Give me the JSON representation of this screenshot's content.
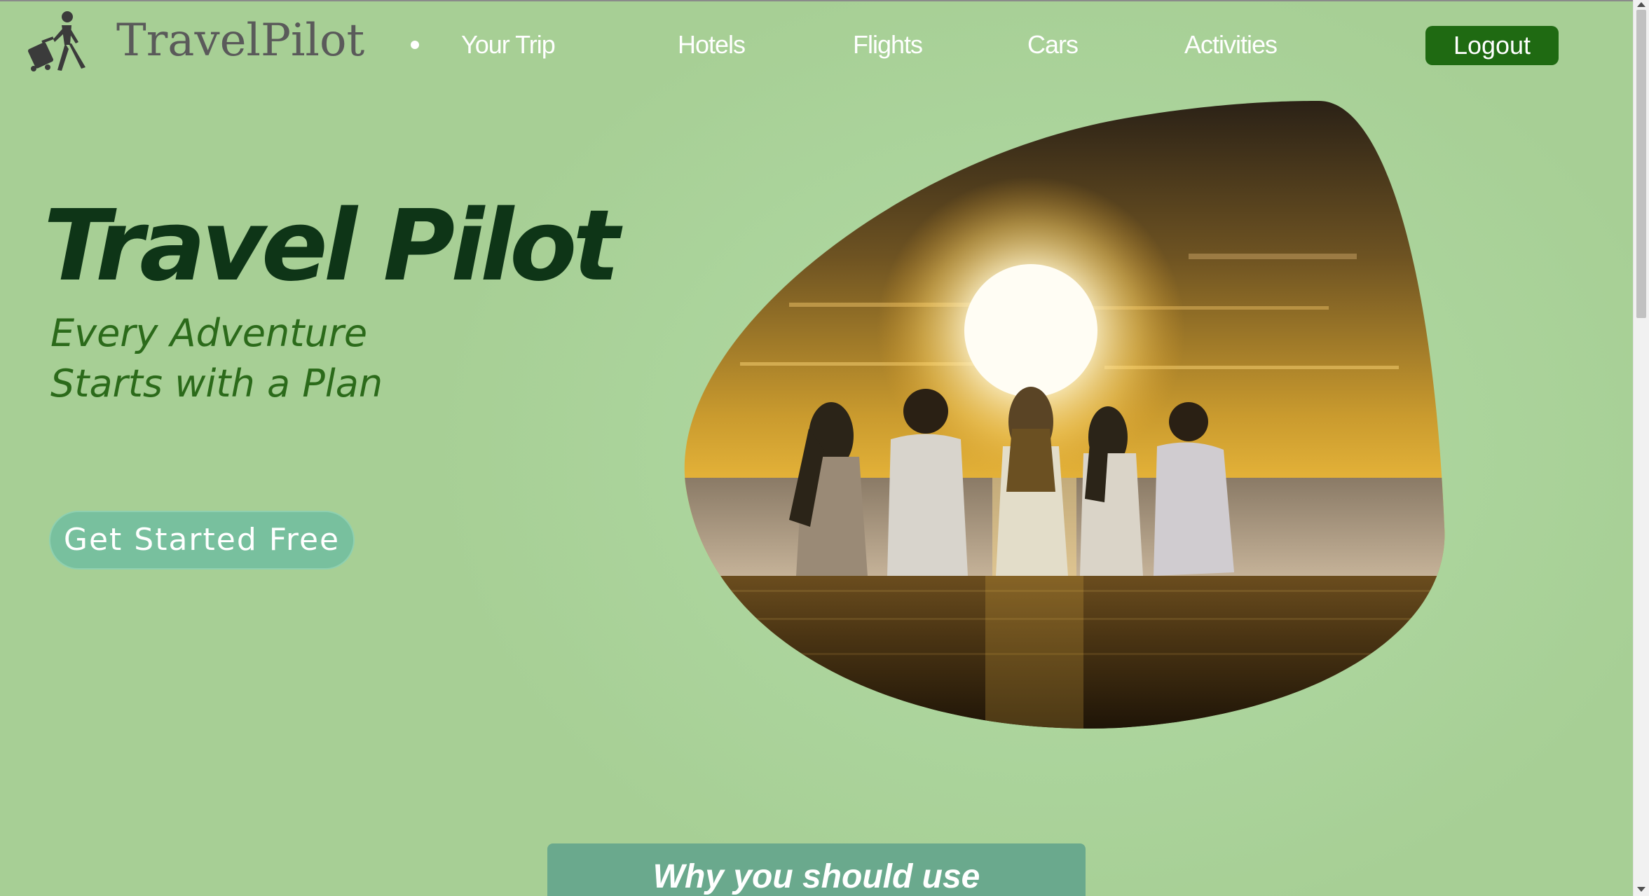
{
  "header": {
    "brand": "TravelPilot",
    "logo_icon": "traveler-with-suitcase-icon",
    "nav": [
      {
        "label": "Your Trip"
      },
      {
        "label": "Hotels"
      },
      {
        "label": "Flights"
      },
      {
        "label": "Cars"
      },
      {
        "label": "Activities"
      }
    ],
    "logout_label": "Logout"
  },
  "hero": {
    "title": "Travel Pilot",
    "tagline_line1": "Every Adventure",
    "tagline_line2": "Starts with a Plan",
    "cta_label": "Get Started Free",
    "image_subject": "friends-watching-sunset-over-sea"
  },
  "why": {
    "title": "Why you should use"
  },
  "colors": {
    "background": "#a7cf95",
    "title": "#0e3517",
    "tagline": "#2b6a1a",
    "logout_bg": "#1f6a12",
    "cta_bg": "#78c09e",
    "why_card_bg": "#6aa98d"
  }
}
